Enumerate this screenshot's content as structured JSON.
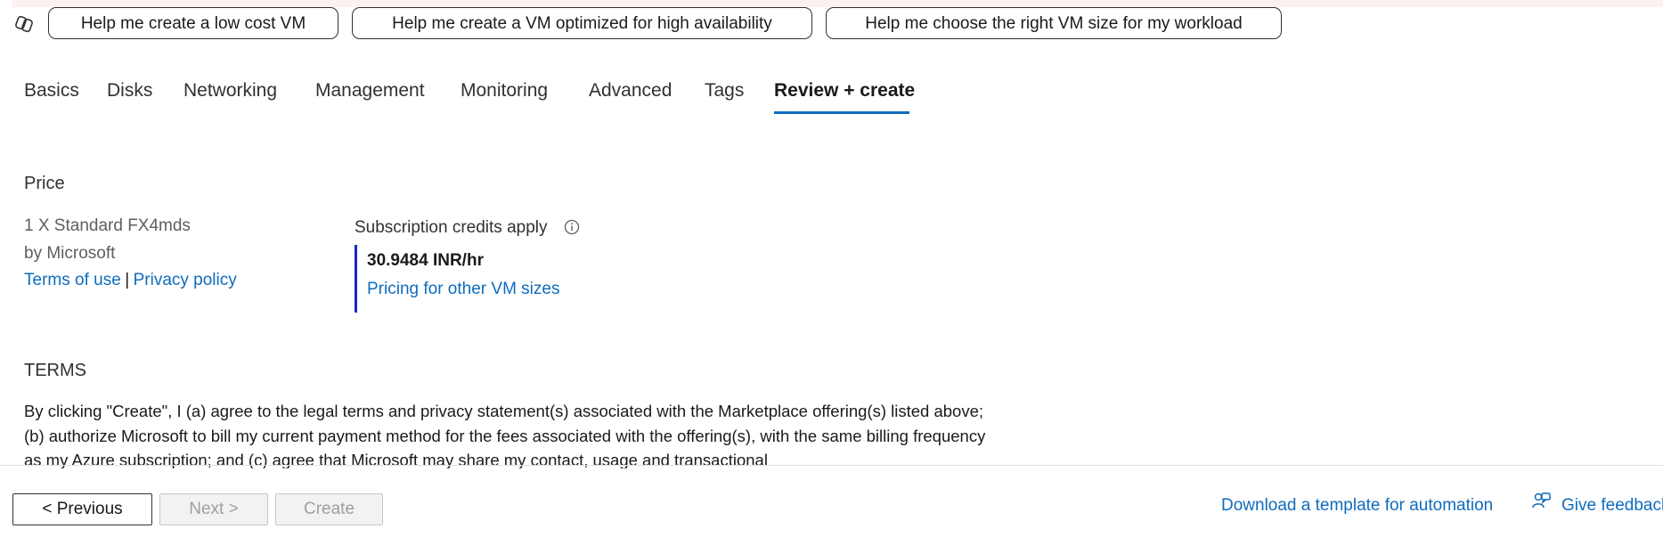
{
  "copilot": {
    "icon": "copilot-icon",
    "suggestions": [
      "Help me create a low cost VM",
      "Help me create a VM optimized for high availability",
      "Help me choose the right VM size for my workload"
    ]
  },
  "tabs": [
    "Basics",
    "Disks",
    "Networking",
    "Management",
    "Monitoring",
    "Advanced",
    "Tags",
    "Review + create"
  ],
  "active_tab": "Review + create",
  "price": {
    "section_title": "Price",
    "product_name": "1 X Standard FX4mds",
    "publisher": "by Microsoft",
    "terms_link": "Terms of use",
    "separator": "|",
    "privacy_link": "Privacy policy",
    "credits_label": "Subscription credits apply",
    "info_icon": "info-icon",
    "rate": "30.9484 INR/hr",
    "pricing_link": "Pricing for other VM sizes"
  },
  "terms": {
    "title": "TERMS",
    "body": "By clicking \"Create\", I (a) agree to the legal terms and privacy statement(s) associated with the Marketplace offering(s) listed above; (b) authorize Microsoft to bill my current payment method for the fees associated with the offering(s), with the same billing frequency as my Azure subscription; and (c) agree that Microsoft may share my contact, usage and transactional"
  },
  "footer": {
    "previous": "< Previous",
    "next": "Next >",
    "create": "Create",
    "download_link": "Download a template for automation",
    "feedback_icon": "feedback-icon",
    "feedback_link": "Give feedback"
  },
  "colors": {
    "link": "#0f6cbd",
    "active_tab_underline": "#0f6cbd",
    "price_bar": "#1a27c9"
  }
}
